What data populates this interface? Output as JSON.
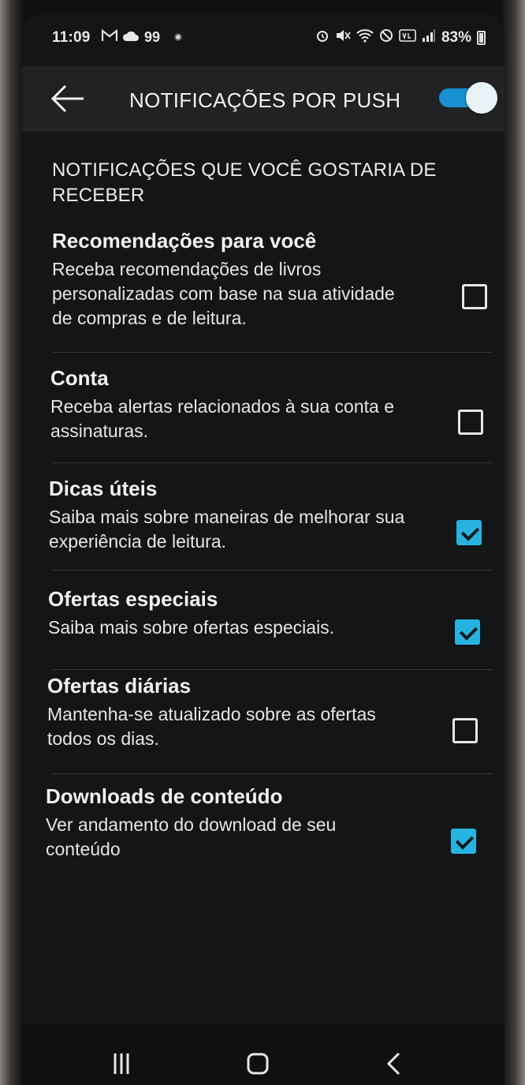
{
  "status_bar": {
    "time": "11:09",
    "left_icons": [
      "gmail-icon",
      "cloud-icon",
      "badge-99-icon"
    ],
    "badge_text": "99",
    "right_icons": [
      "alarm-icon",
      "mute-icon",
      "wifi-icon",
      "dnd-icon",
      "volte-icon",
      "signal-icon"
    ],
    "battery": "83%"
  },
  "appbar": {
    "title": "NOTIFICAÇÕES POR PUSH",
    "toggle_on": true,
    "accent_color": "#1a8fd1"
  },
  "section": {
    "title": "NOTIFICAÇÕES QUE VOCÊ GOSTARIA DE RECEBER"
  },
  "items": [
    {
      "title": "Recomendações para você",
      "desc": "Receba recomendações de livros personalizadas com base na sua atividade de compras e de leitura.",
      "checked": false
    },
    {
      "title": "Conta",
      "desc": "Receba alertas relacionados à sua conta e assinaturas.",
      "checked": false
    },
    {
      "title": "Dicas úteis",
      "desc": "Saiba mais sobre maneiras de melhorar sua experiência de leitura.",
      "checked": true
    },
    {
      "title": "Ofertas especiais",
      "desc": "Saiba mais sobre ofertas especiais.",
      "checked": true
    },
    {
      "title": "Ofertas diárias",
      "desc": "Mantenha-se atualizado sobre as ofertas todos os dias.",
      "checked": false
    },
    {
      "title": "Downloads de conteúdo",
      "desc": "Ver andamento do download de seu conteúdo",
      "checked": true
    }
  ],
  "checkbox_color": "#27b3e0",
  "navbar": {
    "buttons": [
      "recents-icon",
      "home-icon",
      "back-icon"
    ]
  }
}
